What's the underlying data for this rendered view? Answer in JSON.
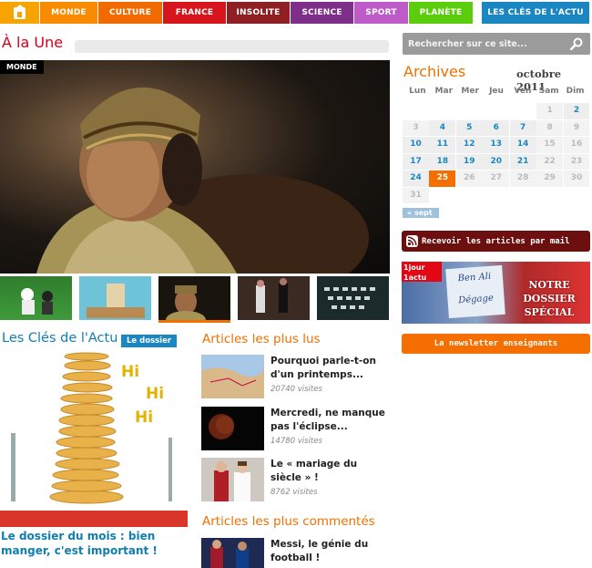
{
  "nav": {
    "items": [
      {
        "label": "MONDE",
        "color": "#f88b00"
      },
      {
        "label": "CULTURE",
        "color": "#f26b00"
      },
      {
        "label": "FRANCE",
        "color": "#d6161c"
      },
      {
        "label": "INSOLITE",
        "color": "#8e2024"
      },
      {
        "label": "SCIENCE",
        "color": "#7d2f8a"
      },
      {
        "label": "SPORT",
        "color": "#bf5bc9"
      },
      {
        "label": "PLANÈTE",
        "color": "#5ccd0c"
      }
    ],
    "home_color": "#f7a400",
    "cles_label": "LES CLÉS DE L'ACTU",
    "cles_color": "#1a86c2"
  },
  "une": {
    "title": "À la Une",
    "badge": "MONDE"
  },
  "search": {
    "placeholder": "Rechercher sur ce site..."
  },
  "archives": {
    "title": "Archives",
    "month": "octobre 2011",
    "days": [
      "Lun",
      "Mar",
      "Mer",
      "Jeu",
      "Ven",
      "Sam",
      "Dim"
    ],
    "weeks": [
      [
        "",
        "",
        "",
        "",
        "",
        "1",
        "2"
      ],
      [
        "3",
        "4",
        "5",
        "6",
        "7",
        "8",
        "9"
      ],
      [
        "10",
        "11",
        "12",
        "13",
        "14",
        "15",
        "16"
      ],
      [
        "17",
        "18",
        "19",
        "20",
        "21",
        "22",
        "23"
      ],
      [
        "24",
        "25",
        "26",
        "27",
        "28",
        "29",
        "30"
      ],
      [
        "31",
        "",
        "",
        "",
        "",
        "",
        ""
      ]
    ],
    "linked": [
      "2",
      "4",
      "5",
      "6",
      "7",
      "10",
      "11",
      "12",
      "13",
      "14",
      "17",
      "18",
      "19",
      "20",
      "21",
      "24"
    ],
    "today": "25",
    "prev": "« sept"
  },
  "sidebar": {
    "mail_button": "Recevoir les articles par mail",
    "promo_logo": "1jour 1actu",
    "promo_text": "NOTRE DOSSIER SPÉCIAL",
    "promo_sign": "Ben Ali Dégage",
    "newsletter": "La newsletter enseignants"
  },
  "cles": {
    "title": "Les Clés de l'Actu",
    "tag": "Le dossier",
    "hi": [
      "Hi",
      "Hi",
      "Hi"
    ],
    "caption": "Le dossier du mois : bien manger, c'est important !"
  },
  "plus_lus": {
    "title": "Articles les plus lus",
    "items": [
      {
        "title": "Pourquoi parle-t-on d'un printemps...",
        "visits": "20740 visites"
      },
      {
        "title": "Mercredi, ne manque pas l'éclipse...",
        "visits": "14780 visites"
      },
      {
        "title": "Le « mariage du siècle » !",
        "visits": "8762 visites"
      }
    ]
  },
  "plus_commentes": {
    "title": "Articles les plus commentés",
    "items": [
      {
        "title": "Messi, le génie du football !"
      }
    ]
  }
}
